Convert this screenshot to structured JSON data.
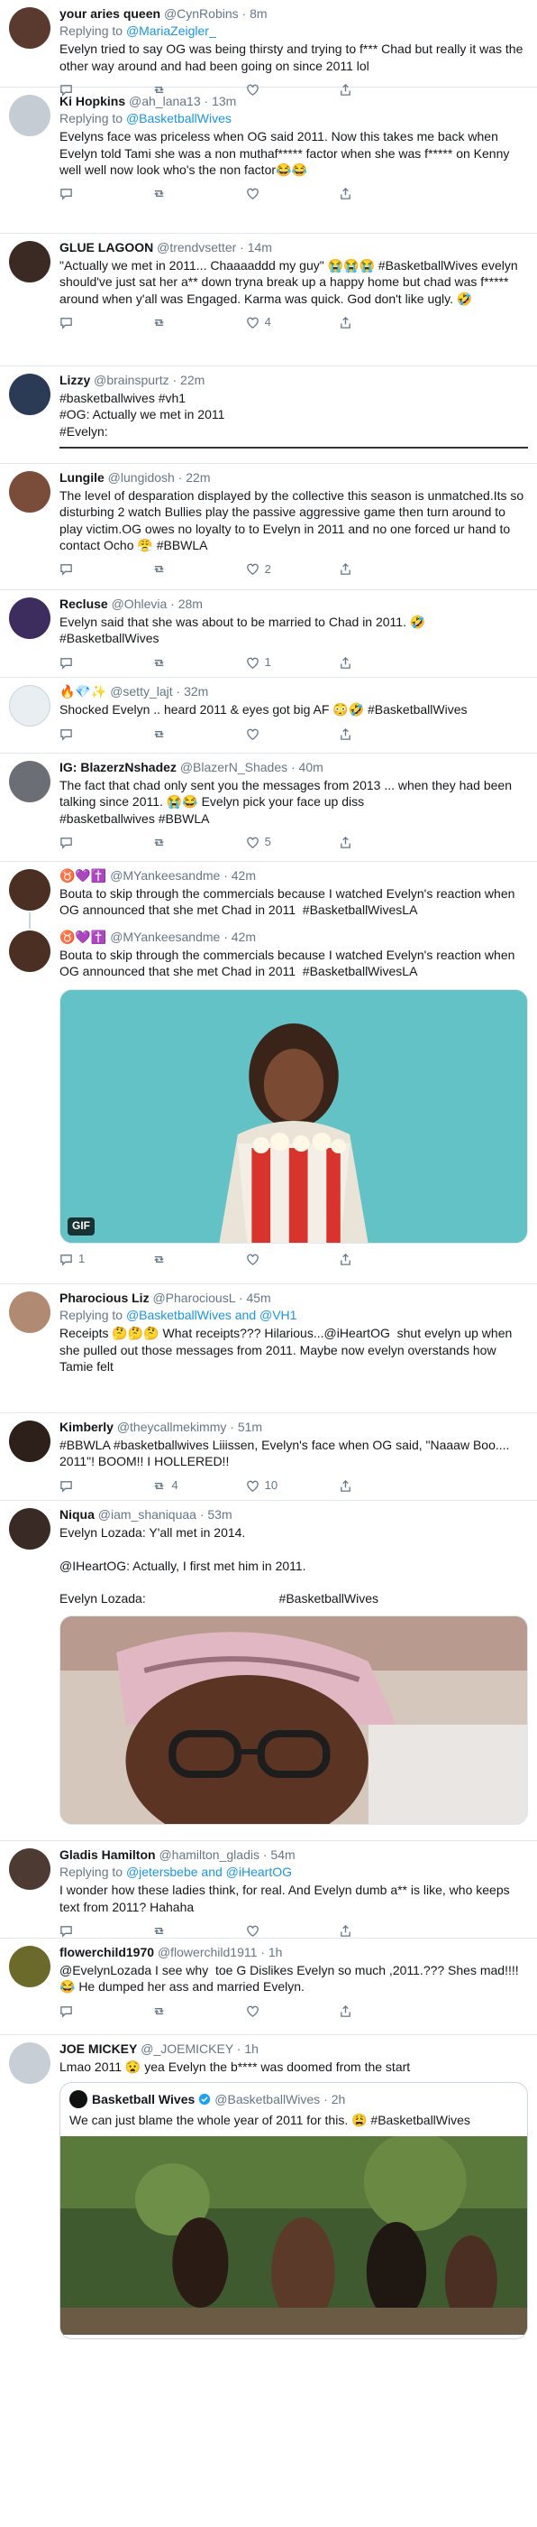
{
  "tweets": [
    {
      "id": "t1",
      "name": "your aries queen",
      "handle": "@CynRobins",
      "time": "· 8m",
      "reply_prefix": "Replying to ",
      "reply_to": "@MariaZeigler_",
      "text": "Evelyn tried to say OG was being thirsty and trying to f*** Chad but really it was the other way around and had been going on since 2011 lol",
      "avatar_color": "#5a3a2e",
      "actions": [
        "",
        "",
        "",
        ""
      ]
    },
    {
      "id": "t2",
      "name": "Ki Hopkins",
      "handle": "@ah_lana13",
      "time": "· 13m",
      "reply_prefix": "Replying to ",
      "reply_to": "@BasketballWives",
      "text": "Evelyns face was priceless when OG said 2011. Now this takes me back when Evelyn told Tami she was a non muthaf***** factor when she was f***** on Kenny well well now look who's the non factor😂😂",
      "avatar_color": "#c5ccd3",
      "actions": [
        "",
        "",
        "",
        ""
      ]
    },
    {
      "id": "t3",
      "name": "GLUE LAGOON",
      "handle": "@trendvsetter",
      "time": "· 14m",
      "text": "\"Actually we met in 2011... Chaaaaddd my guy\" 😭😭😭 #BasketballWives evelyn should've just sat her a** down tryna break up a happy home but chad was f***** around when y'all was Engaged. Karma was quick. God don't like ugly. 🤣",
      "avatar_color": "#3b2a24",
      "actions": [
        "",
        "",
        "4",
        ""
      ]
    },
    {
      "id": "t4",
      "name": "Lizzy",
      "handle": "@brainspurtz",
      "time": "· 22m",
      "text": "#basketballwives #vh1\n#OG: Actually we met in 2011\n#Evelyn:",
      "avatar_color": "#2b3a55"
    },
    {
      "id": "t5",
      "name": "Lungile",
      "handle": "@lungidosh",
      "time": "· 22m",
      "text": "The level of desparation displayed by the collective this season is unmatched.Its so disturbing 2 watch Bullies play the passive aggressive game then turn around to play victim.OG owes no loyalty to to Evelyn in 2011 and no one forced ur hand to contact Ocho 😤 #BBWLA",
      "avatar_color": "#7a4d3a",
      "actions": [
        "",
        "",
        "2",
        ""
      ]
    },
    {
      "id": "t6",
      "name": "Recluse",
      "handle": "@Ohlevia",
      "time": "· 28m",
      "text": "Evelyn said that she was about to be married to Chad in 2011. 🤣\n#BasketballWives",
      "avatar_color": "#3d2c5e",
      "actions": [
        "",
        "",
        "1",
        ""
      ]
    },
    {
      "id": "t7",
      "name": "🔥💎✨",
      "handle": "@setty_lajt",
      "time": "· 32m",
      "text": "Shocked Evelyn .. heard 2011 & eyes got big AF 😳🤣 #BasketballWives",
      "avatar_color": "#e9eef2",
      "actions": [
        "",
        "",
        "",
        ""
      ]
    },
    {
      "id": "t8",
      "name": "IG: BlazerzNshadez",
      "handle": "@BlazerN_Shades",
      "time": "· 40m",
      "text": "The fact that chad only sent you the messages from 2013 ... when they had been talking since 2011. 😭😂 Evelyn pick your face up diss\n#basketballwives #BBWLA",
      "avatar_color": "#6b6f75",
      "actions": [
        "",
        "",
        "5",
        ""
      ]
    },
    {
      "id": "t9",
      "name": "♉️💜✝️",
      "handle": "@MYankeesandme",
      "time": "· 42m",
      "text": "Bouta to skip through the commercials because I watched Evelyn's reaction when OG announced that she met Chad in 2011  #BasketballWivesLA",
      "avatar_color": "#4a2f22",
      "thread": true
    },
    {
      "id": "t10",
      "name": "♉️💜✝️",
      "handle": "@MYankeesandme",
      "time": "· 42m",
      "text": "Bouta to skip through the commercials because I watched Evelyn's reaction when OG announced that she met Chad in 2011  #BasketballWivesLA",
      "avatar_color": "#4a2f22",
      "gif_badge": "GIF",
      "actions": [
        "1",
        "",
        "",
        ""
      ]
    },
    {
      "id": "t11",
      "name": "Pharocious Liz",
      "handle": "@PharociousL",
      "time": "· 45m",
      "reply_prefix": "Replying to ",
      "reply_to": "@BasketballWives and @VH1",
      "text": "Receipts 🤔🤔🤔 What receipts??? Hilarious...@iHeartOG  shut evelyn up when she pulled out those messages from 2011. Maybe now evelyn overstands how Tamie felt",
      "avatar_color": "#b08a72",
      "actions": [
        "",
        "",
        "",
        ""
      ]
    },
    {
      "id": "t12",
      "name": "Kimberly",
      "handle": "@theycallmekimmy",
      "time": "· 51m",
      "text": "#BBWLA #basketballwives Liiissen, Evelyn's face when OG said, \"Naaaw Boo.... 2011\"! BOOM!! I HOLLERED!!",
      "avatar_color": "#2d1f1a",
      "actions": [
        "",
        "4",
        "10",
        ""
      ]
    },
    {
      "id": "t13",
      "name": "Niqua",
      "handle": "@iam_shaniquaa",
      "time": "· 53m",
      "text": "Evelyn Lozada: Y'all met in 2014.\n\n@IHeartOG: Actually, I first met him in 2011.\n\nEvelyn Lozada:                                      #BasketballWives",
      "avatar_color": "#3a2a26",
      "actions": [
        "",
        "",
        "",
        ""
      ]
    },
    {
      "id": "t14",
      "name": "Gladis Hamilton",
      "handle": "@hamilton_gladis",
      "time": "· 54m",
      "reply_prefix": "Replying to ",
      "reply_to": "@jetersbebe and @iHeartOG",
      "text": "I wonder how these ladies think, for real. And Evelyn dumb a** is like, who keeps text from 2011? Hahaha",
      "avatar_color": "#4d3b33",
      "actions": [
        "",
        "",
        "",
        ""
      ]
    },
    {
      "id": "t15",
      "name": "flowerchild1970",
      "handle": "@flowerchild1911",
      "time": "· 1h",
      "text": "@EvelynLozada I see why  toe G Dislikes Evelyn so much ,2011.??? Shes mad!!!!😂 He dumped her ass and married Evelyn.",
      "avatar_color": "#6b6a2a",
      "actions": [
        "",
        "",
        "",
        ""
      ]
    },
    {
      "id": "t16",
      "name": "JOE MICKEY",
      "handle": "@_JOEMICKEY",
      "time": "· 1h",
      "text": "Lmao 2011 😧 yea Evelyn the b**** was doomed from the start",
      "avatar_color": "#c7ced6",
      "quote": {
        "name": "Basketball Wives",
        "handle": "@BasketballWives",
        "time": "· 2h",
        "text": "We can just blame the whole year of 2011 for this. 😩 #BasketballWives"
      }
    }
  ]
}
